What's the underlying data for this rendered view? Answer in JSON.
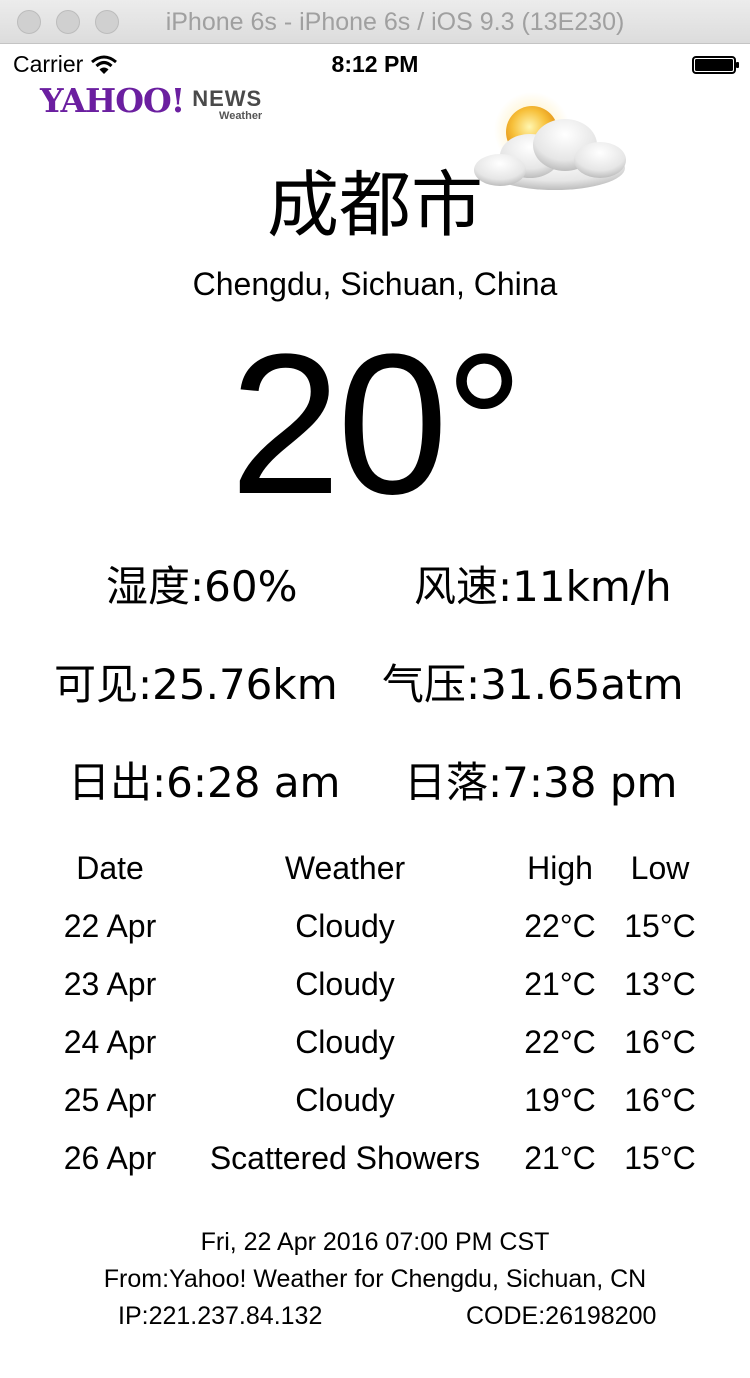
{
  "window": {
    "title": "iPhone 6s - iPhone 6s / iOS 9.3 (13E230)"
  },
  "status_bar": {
    "carrier": "Carrier",
    "time": "8:12 PM",
    "icons": [
      "wifi-icon",
      "battery-icon"
    ]
  },
  "logo": {
    "brand": "YAHOO!",
    "product": "NEWS",
    "sub": "Weather",
    "brand_color": "#6b1fa0"
  },
  "weather_icon": "partly-cloudy-icon",
  "city": {
    "name": "成都市",
    "location": "Chengdu, Sichuan, China"
  },
  "current": {
    "temperature": "20°",
    "humidity": "湿度:60%",
    "wind": "风速:11km/h",
    "visibility": "可见:25.76km",
    "pressure": "气压:31.65atm",
    "sunrise": "日出:6:28 am",
    "sunset": "日落:7:38 pm"
  },
  "forecast": {
    "headers": [
      "Date",
      "Weather",
      "High",
      "Low"
    ],
    "rows": [
      [
        "22 Apr",
        "Cloudy",
        "22°C",
        "15°C"
      ],
      [
        "23 Apr",
        "Cloudy",
        "21°C",
        "13°C"
      ],
      [
        "24 Apr",
        "Cloudy",
        "22°C",
        "16°C"
      ],
      [
        "25 Apr",
        "Cloudy",
        "19°C",
        "16°C"
      ],
      [
        "26 Apr",
        "Scattered Showers",
        "21°C",
        "15°C"
      ]
    ]
  },
  "footer": {
    "date": "Fri, 22 Apr 2016 07:00 PM CST",
    "source": "From:Yahoo! Weather for Chengdu, Sichuan, CN",
    "ip": "IP:221.237.84.132",
    "code": "CODE:26198200"
  }
}
